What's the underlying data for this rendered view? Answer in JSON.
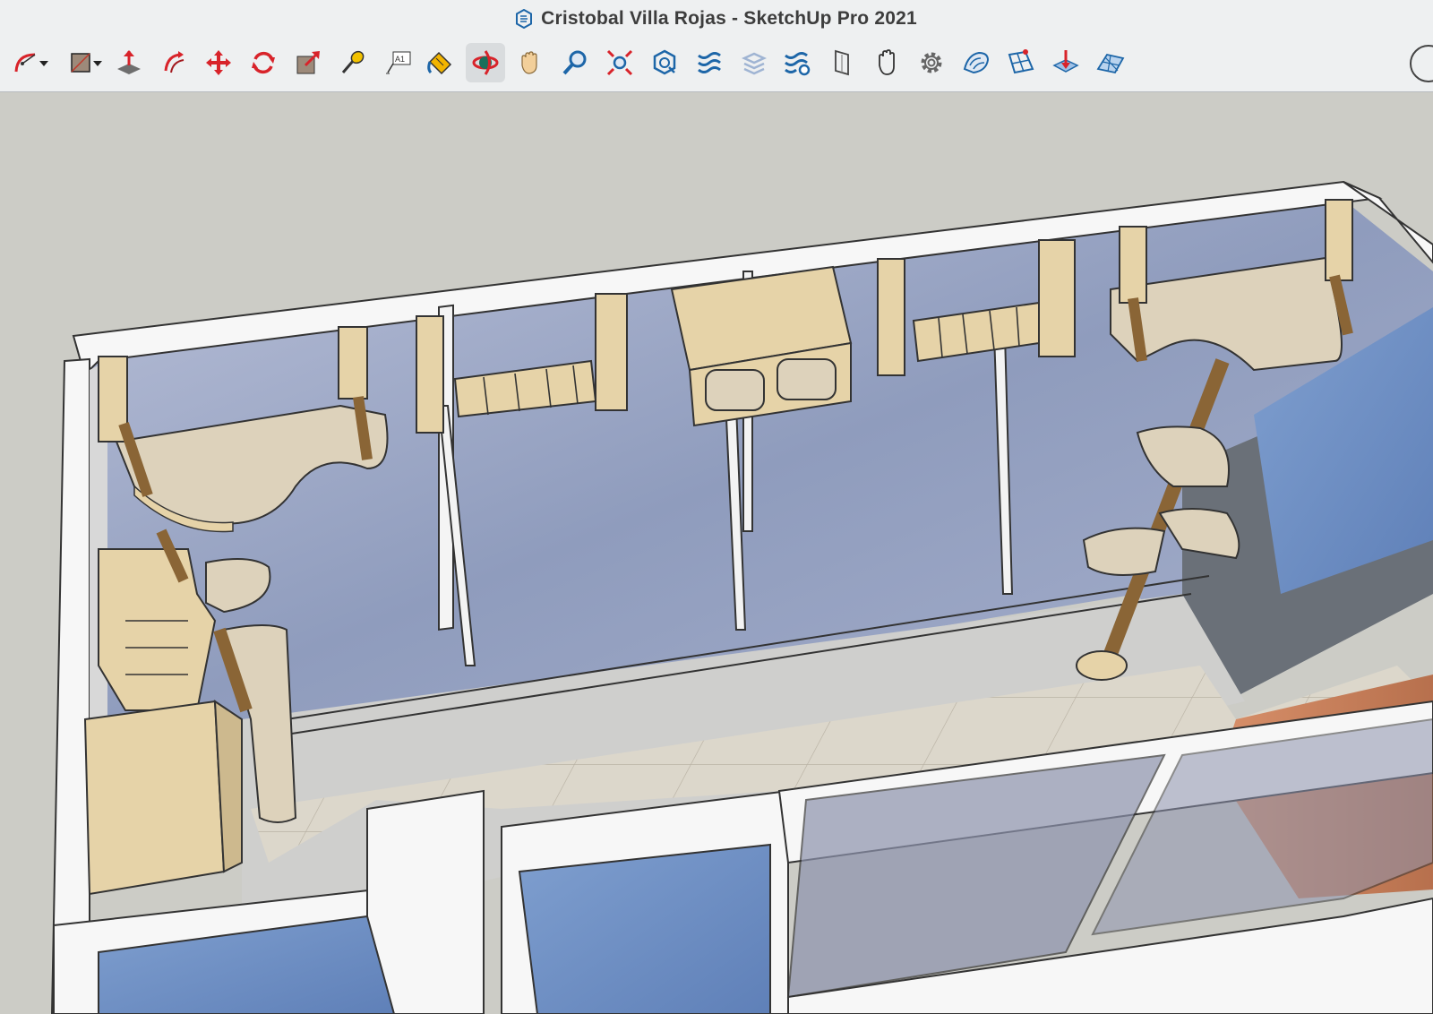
{
  "window": {
    "title": "Cristobal Villa Rojas - SketchUp Pro 2021"
  },
  "toolbar": {
    "tools": [
      {
        "name": "arc-tool",
        "icon": "arc-icon",
        "has_dropdown": true
      },
      {
        "name": "shapes-tool",
        "icon": "rectangle-icon",
        "has_dropdown": true
      },
      {
        "name": "push-pull-tool",
        "icon": "push-pull-icon"
      },
      {
        "name": "follow-me-tool",
        "icon": "follow-me-icon"
      },
      {
        "name": "move-tool",
        "icon": "move-icon"
      },
      {
        "name": "rotate-tool",
        "icon": "rotate-icon"
      },
      {
        "name": "scale-tool",
        "icon": "scale-icon"
      },
      {
        "name": "tape-measure-tool",
        "icon": "tape-measure-icon"
      },
      {
        "name": "text-tool",
        "icon": "text-icon",
        "label": "A1"
      },
      {
        "name": "paint-bucket-tool",
        "icon": "paint-bucket-icon"
      },
      {
        "name": "orbit-tool",
        "icon": "orbit-icon",
        "active": true
      },
      {
        "name": "pan-tool",
        "icon": "pan-icon"
      },
      {
        "name": "zoom-tool",
        "icon": "zoom-icon"
      },
      {
        "name": "zoom-extents-tool",
        "icon": "zoom-extents-icon"
      },
      {
        "name": "3d-warehouse-tool",
        "icon": "3d-warehouse-icon"
      },
      {
        "name": "extension-warehouse-tool",
        "icon": "extension-warehouse-icon"
      },
      {
        "name": "layout-tool",
        "icon": "layout-icon"
      },
      {
        "name": "extension-manager-tool",
        "icon": "extension-manager-icon"
      },
      {
        "name": "section-plane-tool",
        "icon": "section-plane-icon"
      },
      {
        "name": "hand-tool",
        "icon": "hand-icon"
      },
      {
        "name": "settings-tool",
        "icon": "gear-icon"
      },
      {
        "name": "sandbox-tool",
        "icon": "sandbox-icon"
      },
      {
        "name": "add-detail-tool",
        "icon": "add-detail-icon"
      },
      {
        "name": "drape-tool",
        "icon": "drape-icon"
      },
      {
        "name": "from-contours-tool",
        "icon": "from-contours-icon"
      }
    ]
  },
  "colors": {
    "toolbar_bg": "#eef0f1",
    "sketchup_blue": "#1d66a8",
    "tool_red": "#d8232a",
    "sky": "#9aa6c4",
    "wood": "#e6d3a8",
    "carpet": "#ddd2bb",
    "sisal_post": "#b58a4c",
    "floor_tile": "#d8d3c6",
    "wall_white": "#f7f7f7",
    "wood_floor": "#c8835e"
  }
}
